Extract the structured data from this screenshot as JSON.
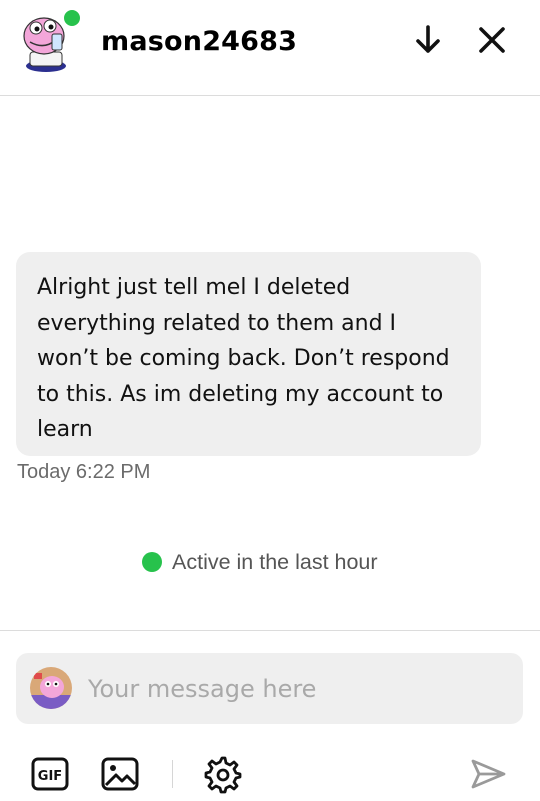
{
  "header": {
    "username": "mason24683"
  },
  "message": {
    "text": "Alright just tell mel I deleted everything related to them and I won’t be coming back. Don’t respond to this. As im deleting my account to learn",
    "timestamp": "Today 6:22 PM"
  },
  "status": {
    "active_text": "Active in the last hour"
  },
  "composer": {
    "placeholder": "Your message here"
  },
  "toolbar": {
    "gif_label": "GIF"
  },
  "icons": {
    "header": [
      "arrow-down-icon",
      "close-icon"
    ],
    "toolbar": [
      "gif-icon",
      "image-icon",
      "gear-icon",
      "send-icon"
    ]
  },
  "colors": {
    "online": "#27c24c",
    "bubble": "#efefef",
    "placeholder": "#a9a9a9",
    "muted_text": "#6b6b6b"
  }
}
